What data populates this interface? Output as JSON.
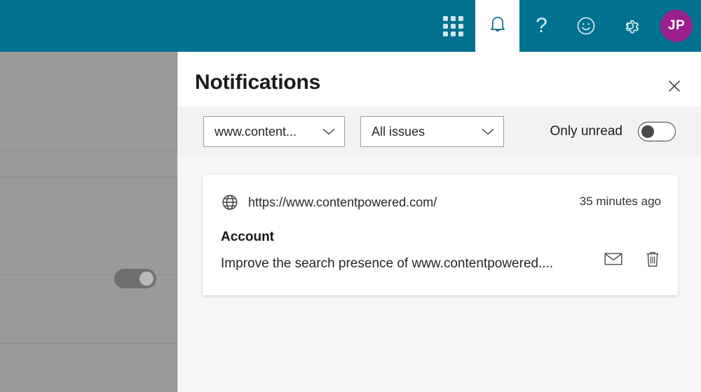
{
  "topbar": {
    "background_color": "#00718f",
    "actions": [
      {
        "name": "app-launcher",
        "icon": "waffle-grid-icon",
        "label": "App launcher"
      },
      {
        "name": "notifications",
        "icon": "bell-icon",
        "label": "Notifications",
        "active": true
      },
      {
        "name": "help",
        "icon": "question-mark-icon",
        "label": "Help"
      },
      {
        "name": "feedback",
        "icon": "smiley-face-icon",
        "label": "Feedback"
      },
      {
        "name": "settings",
        "icon": "gear-icon",
        "label": "Settings"
      }
    ],
    "avatar": {
      "initials": "JP",
      "color": "#9b1f8e"
    }
  },
  "flyout": {
    "title": "Notifications",
    "close_label": "Close",
    "filters": {
      "site": {
        "value": "www.content...",
        "placeholder": "Select a site"
      },
      "issues": {
        "value": "All issues",
        "placeholder": "Select issue type"
      },
      "only_unread": {
        "label": "Only unread",
        "state": "off"
      }
    },
    "notifications": [
      {
        "url": "https://www.contentpowered.com/",
        "time": "35 minutes ago",
        "heading": "Account",
        "text": "Improve the search presence of www.contentpowered....",
        "actions": [
          {
            "name": "mark-as-read",
            "icon": "envelope-icon"
          },
          {
            "name": "delete",
            "icon": "trash-icon"
          }
        ]
      }
    ]
  }
}
